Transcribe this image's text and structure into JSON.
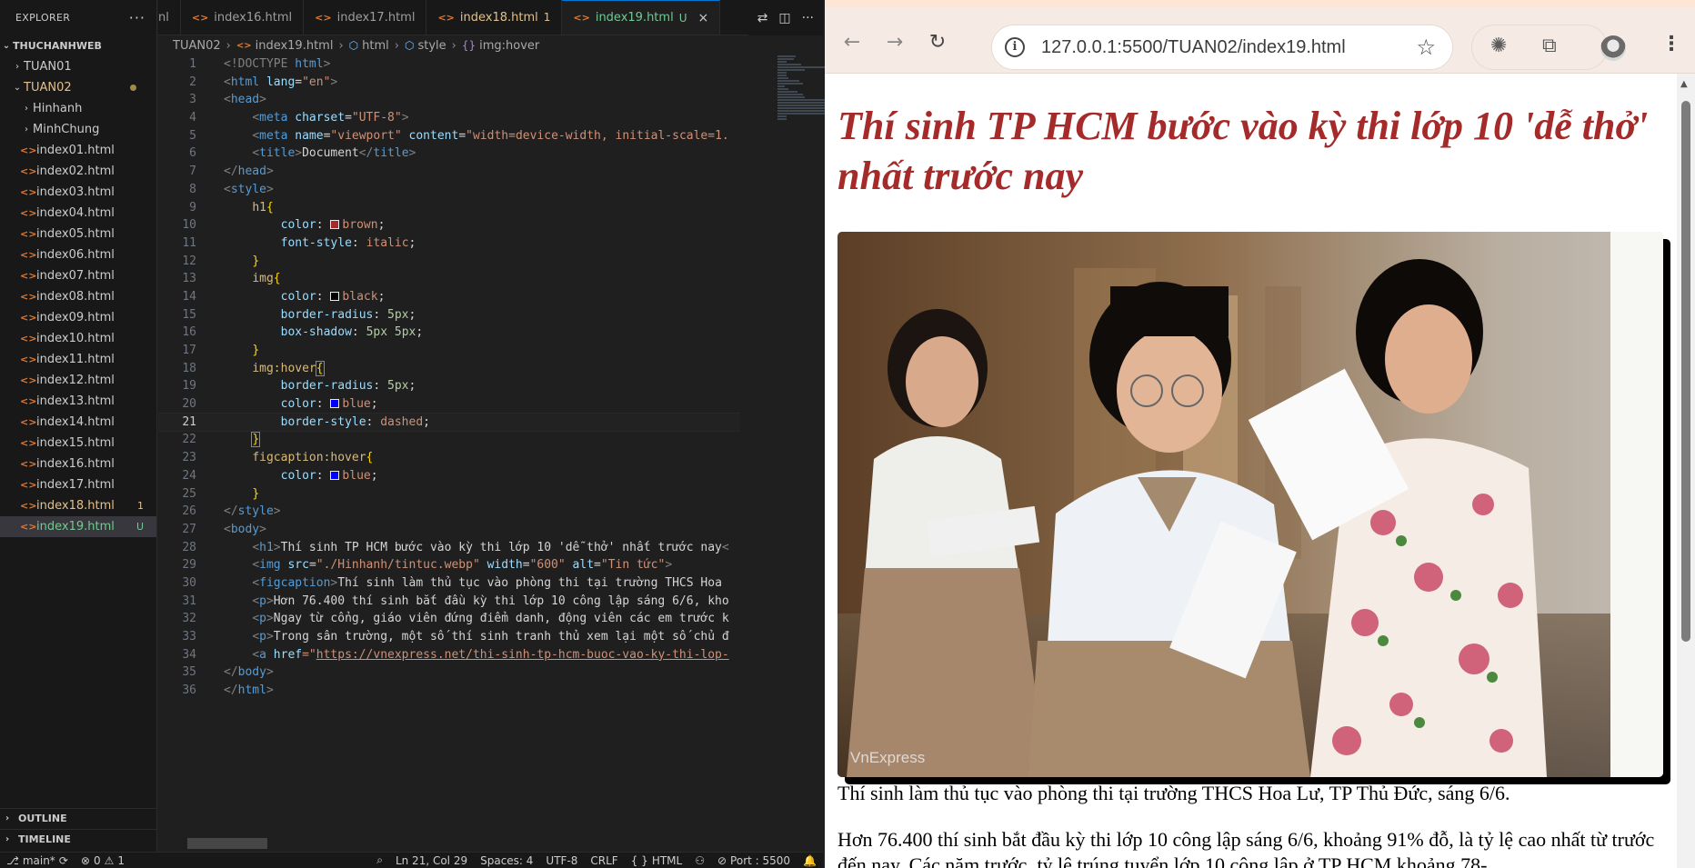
{
  "vscode": {
    "explorer": {
      "title": "EXPLORER",
      "more": "···",
      "root": "THUCHANHWEB",
      "folders": [
        {
          "label": "TUAN01",
          "expanded": false
        },
        {
          "label": "TUAN02",
          "expanded": true
        }
      ],
      "subfolders": [
        "Hinhanh",
        "MinhChung"
      ],
      "files": [
        "index01.html",
        "index02.html",
        "index03.html",
        "index04.html",
        "index05.html",
        "index06.html",
        "index07.html",
        "index08.html",
        "index09.html",
        "index10.html",
        "index11.html",
        "index12.html",
        "index13.html",
        "index14.html",
        "index15.html",
        "index16.html",
        "index17.html"
      ],
      "modified_file": {
        "label": "index18.html",
        "badge": "1"
      },
      "selected_file": {
        "label": "index19.html",
        "badge": "U"
      },
      "sections": [
        "OUTLINE",
        "TIMELINE"
      ]
    },
    "tabs": [
      {
        "label": "nl"
      },
      {
        "label": "index16.html"
      },
      {
        "label": "index17.html"
      },
      {
        "label": "index18.html",
        "badge": "1"
      },
      {
        "label": "index19.html",
        "badge": "U",
        "close": "×"
      }
    ],
    "breadcrumb": [
      "TUAN02",
      "index19.html",
      "html",
      "style",
      "img:hover"
    ],
    "line_numbers": [
      "1",
      "2",
      "3",
      "4",
      "5",
      "6",
      "7",
      "8",
      "9",
      "10",
      "11",
      "12",
      "13",
      "14",
      "15",
      "16",
      "17",
      "18",
      "19",
      "20",
      "21",
      "22",
      "23",
      "24",
      "25",
      "26",
      "27",
      "28",
      "29",
      "30",
      "31",
      "32",
      "33",
      "34",
      "35",
      "36"
    ],
    "code": {
      "l1a": "<!DOCTYPE ",
      "l1b": "html",
      "l1c": ">",
      "l2_tag": "html",
      "l2_attr": "lang",
      "l2_val": "\"en\"",
      "l3_tag": "head",
      "l4_tag": "meta",
      "l4_attr": "charset",
      "l4_val": "\"UTF-8\"",
      "l5_tag": "meta",
      "l5_attr1": "name",
      "l5_val1": "\"viewport\"",
      "l5_attr2": "content",
      "l5_val2": "\"width=device-width, initial-scale=1.",
      "l6_tag": "title",
      "l6_text": "Document",
      "l7_tag": "head",
      "l8_tag": "style",
      "l9_sel": "h1",
      "l10_prop": "color",
      "l10_val": "brown",
      "l11_prop": "font-style",
      "l11_val": "italic",
      "l13_sel": "img",
      "l14_prop": "color",
      "l14_val": "black",
      "l15_prop": "border-radius",
      "l15_val": "5px",
      "l16_prop": "box-shadow",
      "l16_val": "5px 5px",
      "l18_sel": "img:hover",
      "l19_prop": "border-radius",
      "l19_val": "5px",
      "l20_prop": "color",
      "l20_val": "blue",
      "l21_prop": "border-style",
      "l21_val": "dashed",
      "l23_sel": "figcaption:hover",
      "l24_prop": "color",
      "l24_val": "blue",
      "l26_tag": "style",
      "l27_tag": "body",
      "l28_tag": "h1",
      "l28_text": "Thí sinh TP HCM bước vào kỳ thi lớp 10 'dễ thở' nhất trước nay",
      "l29_tag": "img",
      "l29_attr1": "src",
      "l29_val1": "\"./Hinhanh/tintuc.webp\"",
      "l29_attr2": "width",
      "l29_val2": "\"600\"",
      "l29_attr3": "alt",
      "l29_val3": "\"Tin tức\"",
      "l30_tag": "figcaption",
      "l30_text": "Thí sinh làm thủ tục vào phòng thi tại trường THCS Hoa",
      "l31_tag": "p",
      "l31_text": "Hơn 76.400 thí sinh bắt đầu kỳ thi lớp 10 công lập sáng 6/6, kho",
      "l32_tag": "p",
      "l32_text": "Ngay từ cổng, giáo viên đứng điểm danh, động viên các em trước k",
      "l33_tag": "p",
      "l33_text": "Trong sân trường, một số thí sinh tranh thủ xem lại một số chủ đ",
      "l34_tag": "a",
      "l34_attr": "href",
      "l34_eq": "=\"",
      "l34_url": "https://vnexpress.net/thi-sinh-tp-hcm-buoc-vao-ky-thi-lop-",
      "l35_tag": "body",
      "l36_tag": "html"
    },
    "colors": {
      "brown": "#a52a2a",
      "black": "#000000",
      "blue": "#0000ff"
    },
    "statusbar": {
      "branch": "main*",
      "sync_icon": "sync-icon",
      "errors": "0",
      "warnings": "1",
      "position": "Ln 21, Col 29",
      "spaces": "Spaces: 4",
      "encoding": "UTF-8",
      "eol": "CRLF",
      "language": "HTML",
      "braces": "{ }",
      "port": "Port : 5500"
    }
  },
  "chrome": {
    "url": "127.0.0.1:5500/TUAN02/index19.html",
    "page": {
      "h1": "Thí sinh TP HCM bước vào kỳ thi lớp 10 'dễ thở' nhất trước nay",
      "watermark": "VnExpress",
      "figcaption": "Thí sinh làm thủ tục vào phòng thi tại trường THCS Hoa Lư, TP Thủ Đức, sáng 6/6.",
      "paragraph1": "Hơn 76.400 thí sinh bắt đầu kỳ thi lớp 10 công lập sáng 6/6, khoảng 91% đỗ, là tỷ lệ cao nhất từ trước đến nay. Các năm trước, tỷ lệ trúng tuyển lớp 10 công lập ở TP HCM khoảng 78-"
    }
  }
}
